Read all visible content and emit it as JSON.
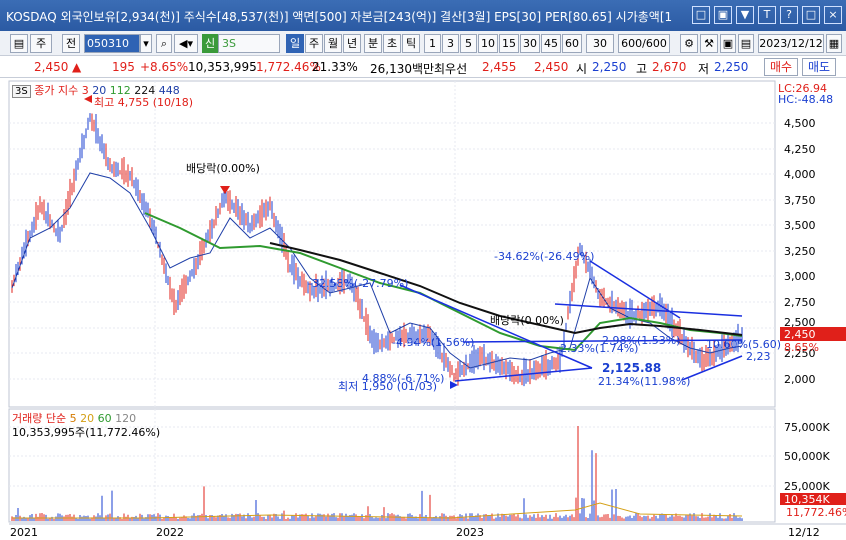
{
  "titlebar": {
    "title": "KOSDAQ 외국인보유[2,934(천)] 주식수[48,537(천)] 액면[500] 자본금[243(억)] 결산[3월] EPS[30] PER[80.65] 시가총액[1",
    "controls": [
      "□",
      "□",
      "▼",
      "T",
      "?",
      "□",
      "×"
    ]
  },
  "toolbar": {
    "stock_code": "050310",
    "buttons_left": [
      "주",
      "전"
    ],
    "check_label": "신",
    "indicator_value": "3S",
    "period_buttons": [
      "일",
      "주",
      "월",
      "년",
      "분",
      "초",
      "틱"
    ],
    "active_period": "일",
    "minute_buttons": [
      "1",
      "3",
      "5",
      "10",
      "15",
      "30",
      "45",
      "60"
    ],
    "interval_value": "30",
    "count_value": "600/600",
    "date_value": "2023/12/12"
  },
  "pricebar": {
    "price": "2,450",
    "change": "195",
    "change_pct": "+8.65%",
    "volume": "10,353,995",
    "volume_pct": "1,772.46%",
    "turnover": "21.33%",
    "amount": "26,130백만",
    "best_ask_label": "최우선",
    "best_ask": "2,455",
    "best_bid": "2,450",
    "open_label": "시",
    "open": "2,250",
    "high_label": "고",
    "high": "2,670",
    "low_label": "저",
    "low": "2,250",
    "buy_label": "매수",
    "sell_label": "매도"
  },
  "chart_panel": {
    "legend_box": "3S",
    "legend_title": "종가 지수 3",
    "ma_labels": [
      "20",
      "112",
      "224",
      "448"
    ],
    "lc": "LC:26.94",
    "hc": "HC:-48.48",
    "price_axis": [
      "4,500",
      "4,250",
      "4,000",
      "3,750",
      "3,500",
      "3,250",
      "3,000",
      "2,750",
      "2,500",
      "2,250",
      "2,000"
    ],
    "current_price_tag": "2,450",
    "current_pct_tag": "8.65%",
    "right_label": "2,23",
    "annotations": {
      "max": "최고 4,755 (10/18)",
      "dividend1": "배당락(0.00%)",
      "dividend2": "배당락(0.00%)",
      "pct1": "-32.58%(-27.79%)",
      "pct2": "-34.62%(-26.49%)",
      "pct3": "-4.94%(1.56%)",
      "pct4": "4.88%(-6.71%)",
      "pct5": "-2.33%(1.74%)",
      "pct6": "-2.98%(1.53%)",
      "pct7": "10.60%(5.60)",
      "low_label": "최저 1,950 (01/03)",
      "pivot": "2,125.88",
      "pct8": "21.34%(11.98%)"
    }
  },
  "volume_panel": {
    "legend_title": "거래량 단순",
    "ma_labels": [
      "5",
      "20",
      "60",
      "120"
    ],
    "volume_text": "10,353,995주(11,772.46%)",
    "axis": [
      "75,000K",
      "50,000K",
      "25,000K"
    ],
    "current_volume_tag": "10,354K",
    "current_volume_pct": "11,772.46%"
  },
  "x_axis": {
    "labels": [
      "2021",
      "2022",
      "2023"
    ],
    "right_label": "12/12"
  },
  "colors": {
    "up": "#e0201a",
    "down": "#1a3fd0",
    "ma20": "#1f3fa8",
    "ma112": "#2f9a2f",
    "ma224": "#111111",
    "trendline": "#1a2fe0"
  }
}
